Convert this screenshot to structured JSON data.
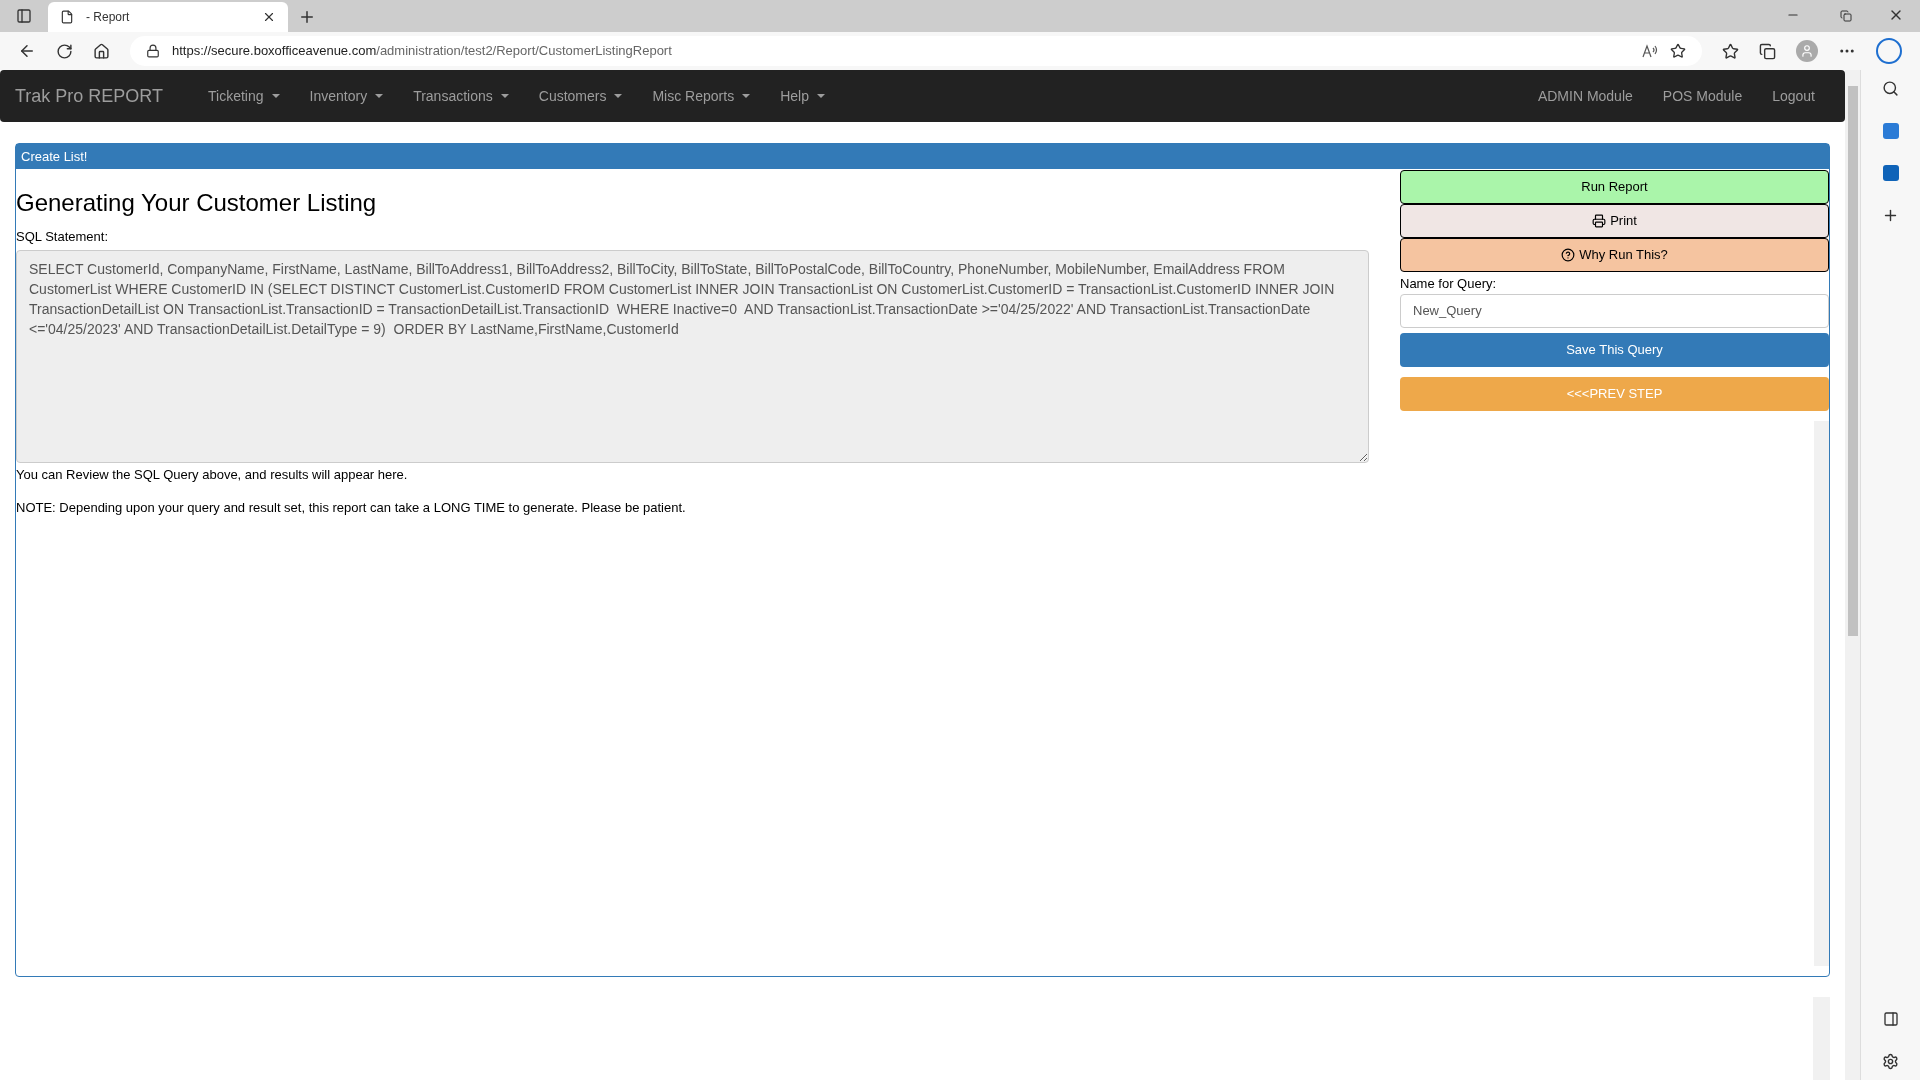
{
  "browser": {
    "tab": {
      "title": "- Report",
      "selected": true
    },
    "url": {
      "host": "https://secure.boxofficeavenue.com",
      "path": "/administration/test2/Report/CustomerListingReport"
    }
  },
  "navbar": {
    "brand": "Trak Pro REPORT",
    "menus": [
      {
        "label": "Ticketing"
      },
      {
        "label": "Inventory"
      },
      {
        "label": "Transactions"
      },
      {
        "label": "Customers"
      },
      {
        "label": "Misc Reports"
      },
      {
        "label": "Help"
      }
    ],
    "right_links": [
      "ADMIN Module",
      "POS Module",
      "Logout"
    ]
  },
  "panel": {
    "heading": "Create List!",
    "title": "Generating Your Customer Listing",
    "sql_label": "SQL Statement:",
    "sql": "SELECT CustomerId, CompanyName, FirstName, LastName, BillToAddress1, BillToAddress2, BillToCity, BillToState, BillToPostalCode, BillToCountry, PhoneNumber, MobileNumber, EmailAddress FROM CustomerList WHERE CustomerID IN (SELECT DISTINCT CustomerList.CustomerID FROM CustomerList INNER JOIN TransactionList ON CustomerList.CustomerID = TransactionList.CustomerID INNER JOIN TransactionDetailList ON TransactionList.TransactionID = TransactionDetailList.TransactionID  WHERE Inactive=0  AND TransactionList.TransactionDate >='04/25/2022' AND TransactionList.TransactionDate <='04/25/2023' AND TransactionDetailList.DetailType = 9)  ORDER BY LastName,FirstName,CustomerId",
    "notes": [
      "You can Review the SQL Query above, and results will appear here.",
      "NOTE: Depending upon your query and result set, this report can take a LONG TIME to generate. Please be patient."
    ],
    "actions": [
      {
        "kind": "run",
        "label": "Run Report"
      },
      {
        "kind": "print",
        "label": "Print"
      },
      {
        "kind": "why",
        "label": "Why Run This?"
      }
    ],
    "query_label": "Name for Query:",
    "query_value": "New_Query",
    "save": "Save This Query",
    "prev": "<<<PREV STEP"
  }
}
